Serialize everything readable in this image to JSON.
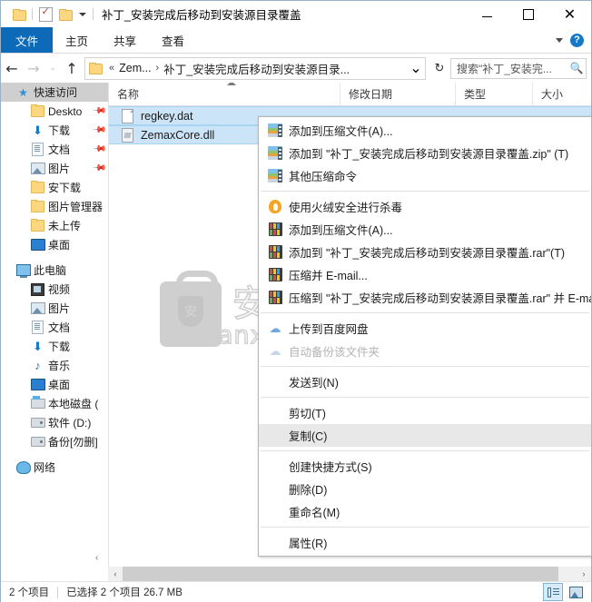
{
  "window": {
    "title": "补丁_安装完成后移动到安装源目录覆盖",
    "quick_access_icons": [
      "folder-icon",
      "properties-icon",
      "new-folder-icon",
      "customize-caret-icon"
    ],
    "minimize_label": "最小化",
    "maximize_label": "最大化",
    "close_label": "关闭"
  },
  "ribbon": {
    "tabs": [
      {
        "label": "文件",
        "active": true
      },
      {
        "label": "主页",
        "active": false
      },
      {
        "label": "共享",
        "active": false
      },
      {
        "label": "查看",
        "active": false
      }
    ],
    "expand_icon": "chevron-down-icon",
    "help_label": "?"
  },
  "addressbar": {
    "back_glyph": "←",
    "forward_glyph": "→",
    "recent_glyph": "⌄",
    "up_glyph": "↑",
    "crumb_prefix": "«",
    "crumbs": [
      "Zem...",
      "补丁_安装完成后移动到安装源目录..."
    ],
    "crumb_sep": "›",
    "dropdown_glyph": "⌄",
    "refresh_glyph": "↻"
  },
  "search": {
    "placeholder": "搜索\"补丁_安装完...",
    "icon": "search-icon"
  },
  "sidebar": {
    "items": [
      {
        "label": "快速访问",
        "icon": "star-icon",
        "indent": 0,
        "selected": true,
        "pinned": false
      },
      {
        "label": "Deskto",
        "icon": "folder-icon",
        "indent": 1,
        "selected": false,
        "pinned": true
      },
      {
        "label": "下载",
        "icon": "download-icon",
        "indent": 1,
        "selected": false,
        "pinned": true
      },
      {
        "label": "文档",
        "icon": "document-icon",
        "indent": 1,
        "selected": false,
        "pinned": true
      },
      {
        "label": "图片",
        "icon": "picture-icon",
        "indent": 1,
        "selected": false,
        "pinned": true
      },
      {
        "label": "安下载",
        "icon": "folder-icon",
        "indent": 1,
        "selected": false,
        "pinned": false
      },
      {
        "label": "图片管理器",
        "icon": "folder-icon",
        "indent": 1,
        "selected": false,
        "pinned": false
      },
      {
        "label": "未上传",
        "icon": "folder-icon",
        "indent": 1,
        "selected": false,
        "pinned": false
      },
      {
        "label": "桌面",
        "icon": "desktop-icon",
        "indent": 1,
        "selected": false,
        "pinned": false
      },
      {
        "label": "此电脑",
        "icon": "this-pc-icon",
        "indent": 0,
        "selected": false,
        "pinned": false,
        "spacer_before": true
      },
      {
        "label": "视频",
        "icon": "video-icon",
        "indent": 1,
        "selected": false,
        "pinned": false
      },
      {
        "label": "图片",
        "icon": "picture-icon",
        "indent": 1,
        "selected": false,
        "pinned": false
      },
      {
        "label": "文档",
        "icon": "document-icon",
        "indent": 1,
        "selected": false,
        "pinned": false
      },
      {
        "label": "下载",
        "icon": "download-icon",
        "indent": 1,
        "selected": false,
        "pinned": false
      },
      {
        "label": "音乐",
        "icon": "music-icon",
        "indent": 1,
        "selected": false,
        "pinned": false
      },
      {
        "label": "桌面",
        "icon": "desktop-icon",
        "indent": 1,
        "selected": false,
        "pinned": false
      },
      {
        "label": "本地磁盘 (",
        "icon": "system-disk-icon",
        "indent": 1,
        "selected": false,
        "pinned": false
      },
      {
        "label": "软件 (D:)",
        "icon": "disk-icon",
        "indent": 1,
        "selected": false,
        "pinned": false
      },
      {
        "label": "备份[勿删]",
        "icon": "disk-icon",
        "indent": 1,
        "selected": false,
        "pinned": false
      },
      {
        "label": "网络",
        "icon": "network-icon",
        "indent": 0,
        "selected": false,
        "pinned": false,
        "spacer_before": true
      }
    ],
    "collapse_glyph": "‹"
  },
  "filepane": {
    "columns": [
      {
        "label": "名称",
        "sorted": true
      },
      {
        "label": "修改日期",
        "sorted": false
      },
      {
        "label": "类型",
        "sorted": false
      },
      {
        "label": "大小",
        "sorted": false
      }
    ],
    "rows": [
      {
        "name": "regkey.dat",
        "icon": "generic-file-icon",
        "selected": true
      },
      {
        "name": "ZemaxCore.dll",
        "icon": "dll-file-icon",
        "selected": true
      }
    ]
  },
  "watermark": {
    "big_text": "安下载",
    "small_text": "anxz.com",
    "badge_char": "安"
  },
  "context_menu": {
    "items": [
      {
        "label": "添加到压缩文件(A)...",
        "icon": "zip-icon",
        "type": "item"
      },
      {
        "label": "添加到 \"补丁_安装完成后移动到安装源目录覆盖.zip\" (T)",
        "icon": "zip-icon",
        "type": "item"
      },
      {
        "label": "其他压缩命令",
        "icon": "zip-icon",
        "type": "item"
      },
      {
        "type": "separator"
      },
      {
        "label": "使用火绒安全进行杀毒",
        "icon": "huorong-icon",
        "type": "item"
      },
      {
        "label": "添加到压缩文件(A)...",
        "icon": "winrar-icon",
        "type": "item"
      },
      {
        "label": "添加到 \"补丁_安装完成后移动到安装源目录覆盖.rar\"(T)",
        "icon": "winrar-icon",
        "type": "item"
      },
      {
        "label": "压缩并 E-mail...",
        "icon": "winrar-icon",
        "type": "item"
      },
      {
        "label": "压缩到 \"补丁_安装完成后移动到安装源目录覆盖.rar\" 并 E-mail",
        "icon": "winrar-icon",
        "type": "item"
      },
      {
        "type": "separator"
      },
      {
        "label": "上传到百度网盘",
        "icon": "baidu-cloud-icon",
        "type": "item"
      },
      {
        "label": "自动备份该文件夹",
        "icon": "baidu-cloud-icon",
        "type": "item",
        "disabled": true
      },
      {
        "type": "separator"
      },
      {
        "label": "发送到(N)",
        "icon": "none",
        "type": "item"
      },
      {
        "type": "separator"
      },
      {
        "label": "剪切(T)",
        "icon": "none",
        "type": "item"
      },
      {
        "label": "复制(C)",
        "icon": "none",
        "type": "item",
        "highlighted": true
      },
      {
        "type": "separator"
      },
      {
        "label": "创建快捷方式(S)",
        "icon": "none",
        "type": "item"
      },
      {
        "label": "删除(D)",
        "icon": "none",
        "type": "item"
      },
      {
        "label": "重命名(M)",
        "icon": "none",
        "type": "item"
      },
      {
        "type": "separator"
      },
      {
        "label": "属性(R)",
        "icon": "none",
        "type": "item"
      }
    ]
  },
  "scrollbar": {
    "left_glyph": "‹",
    "right_glyph": "›"
  },
  "statusbar": {
    "item_count": "2 个项目",
    "selection": "已选择 2 个项目  26.7 MB",
    "view_details_label": "详细信息",
    "view_large_label": "大图标"
  },
  "colors": {
    "accent": "#0d6ab8",
    "selection": "#cce4f7",
    "menu_highlight": "#e8e8e8",
    "nav_selected": "#cfcfcf"
  }
}
